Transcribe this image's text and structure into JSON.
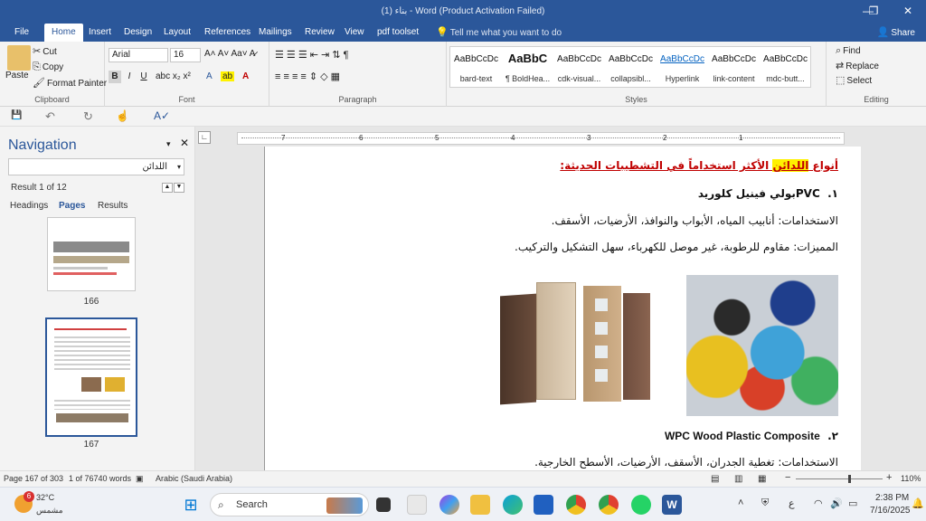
{
  "window": {
    "title": "بناء (1) - Word (Product Activation Failed)"
  },
  "tabs": [
    "File",
    "Home",
    "Insert",
    "Design",
    "Layout",
    "References",
    "Mailings",
    "Review",
    "View",
    "pdf toolset"
  ],
  "active_tab": "Home",
  "tell_me": "Tell me what you want to do",
  "share": "Share",
  "clipboard": {
    "paste": "Paste",
    "cut": "Cut",
    "copy": "Copy",
    "format_painter": "Format Painter",
    "label": "Clipboard"
  },
  "font": {
    "name": "Arial",
    "size": "16",
    "label": "Font"
  },
  "paragraph": {
    "label": "Paragraph"
  },
  "styles": {
    "label": "Styles",
    "items": [
      {
        "preview": "AaBbCcDc",
        "name": "bard-text"
      },
      {
        "preview": "AaBbC",
        "name": "¶ BoldHea..."
      },
      {
        "preview": "AaBbCcDc",
        "name": "cdk-visual..."
      },
      {
        "preview": "AaBbCcDc",
        "name": "collapsibl..."
      },
      {
        "preview": "AaBbCcDc",
        "name": "Hyperlink"
      },
      {
        "preview": "AaBbCcDc",
        "name": "link-content"
      },
      {
        "preview": "AaBbCcDc",
        "name": "mdc-butt..."
      }
    ]
  },
  "editing": {
    "find": "Find",
    "replace": "Replace",
    "select": "Select",
    "label": "Editing"
  },
  "navigation": {
    "title": "Navigation",
    "search": "اللدائن",
    "result": "Result 1 of 12",
    "tabs": [
      "Headings",
      "Pages",
      "Results"
    ],
    "active_tab": "Pages",
    "pages": [
      "166",
      "167"
    ]
  },
  "ruler_numbers": [
    "7",
    "6",
    "5",
    "4",
    "3",
    "2",
    "1"
  ],
  "document": {
    "heading_prefix": "أنواع ",
    "heading_highlight": "اللدائن",
    "heading_suffix": " الأكثر استخداماً في التشطيبات الحديثة:",
    "item1_num": "١.",
    "item1_title": "PVCبولي فينيل كلوريد",
    "item1_uses": "الاستخدامات: أنابيب المياه، الأبواب والنوافذ، الأرضيات، الأسقف.",
    "item1_features": "المميزات: مقاوم للرطوبة، غير موصل للكهرباء، سهل التشكيل والتركيب.",
    "item2_num": "٢.",
    "item2_title": "WPC Wood Plastic Composite",
    "item2_uses": "الاستخدامات: تغطية الجدران، الأسقف، الأرضيات، الأسطح الخارجية."
  },
  "status": {
    "page": "Page 167 of 303",
    "words": "1 of 76740 words",
    "language": "Arabic (Saudi Arabia)",
    "zoom": "110%"
  },
  "taskbar": {
    "weather_temp": "32°C",
    "weather_desc": "مشمس",
    "weather_badge": "6",
    "search": "Search",
    "time": "2:38 PM",
    "date": "7/16/2025",
    "lang": "ع"
  },
  "colors": {
    "word_blue": "#2b579a",
    "heading_red": "#c00000",
    "highlight": "#fff200"
  }
}
